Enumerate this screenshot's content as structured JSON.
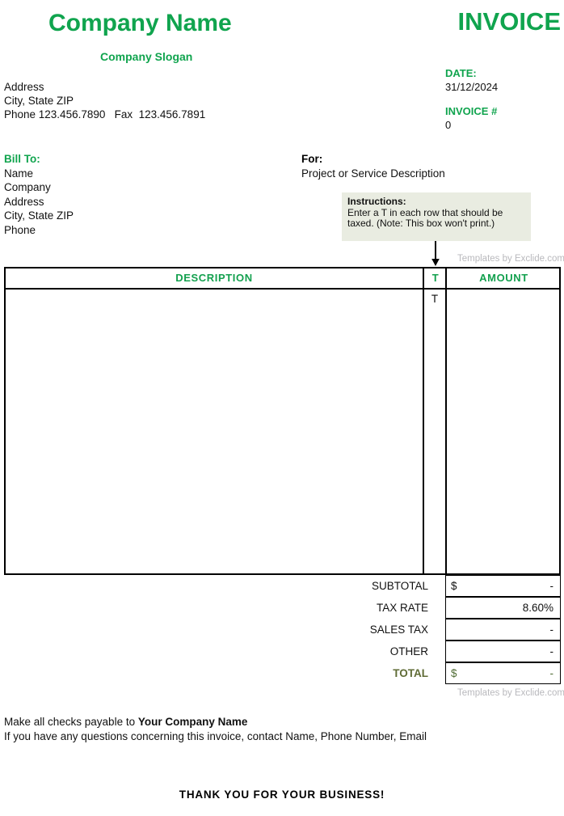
{
  "header": {
    "company_name": "Company Name",
    "company_slogan": "Company Slogan",
    "invoice_title": "INVOICE",
    "accent_color": "#10a44e"
  },
  "address": {
    "line1": "Address",
    "line2": "City, State ZIP",
    "line3": "Phone 123.456.7890   Fax  123.456.7891"
  },
  "meta": {
    "date_label": "DATE:",
    "date_value": "31/12/2024",
    "invoice_number_label": "INVOICE #",
    "invoice_number_value": "0"
  },
  "bill_to": {
    "title": "Bill To:",
    "lines": [
      "Name",
      "Company",
      "Address",
      "City, State ZIP",
      "Phone"
    ]
  },
  "for_section": {
    "title": "For:",
    "description": "Project or Service Description"
  },
  "instructions": {
    "title": "Instructions:",
    "body": "Enter a T in each row that should be taxed.  (Note: This box won't print.)",
    "background_color": "#e9ece1"
  },
  "watermark": {
    "text": "Templates by Exclide.com",
    "color": "#b9b9bd"
  },
  "items_table": {
    "columns": {
      "description": "DESCRIPTION",
      "tax_flag": "T",
      "amount": "AMOUNT"
    },
    "rows": [
      {
        "description": "",
        "tax_flag": "T",
        "amount": ""
      }
    ]
  },
  "totals": [
    {
      "label": "SUBTOTAL",
      "currency": "$",
      "value": "-",
      "emphasis": false
    },
    {
      "label": "TAX RATE",
      "currency": "",
      "value": "8.60%",
      "emphasis": false
    },
    {
      "label": "SALES TAX",
      "currency": "",
      "value": "-",
      "emphasis": false
    },
    {
      "label": "OTHER",
      "currency": "",
      "value": "-",
      "emphasis": false
    },
    {
      "label": "TOTAL",
      "currency": "$",
      "value": "-",
      "emphasis": true
    }
  ],
  "footer": {
    "payable_prefix": "Make all checks payable to ",
    "payable_company": "Your Company Name",
    "questions_line": "If you have any questions concerning this invoice, contact Name, Phone Number, Email",
    "thank_you": "THANK YOU FOR YOUR BUSINESS!"
  }
}
